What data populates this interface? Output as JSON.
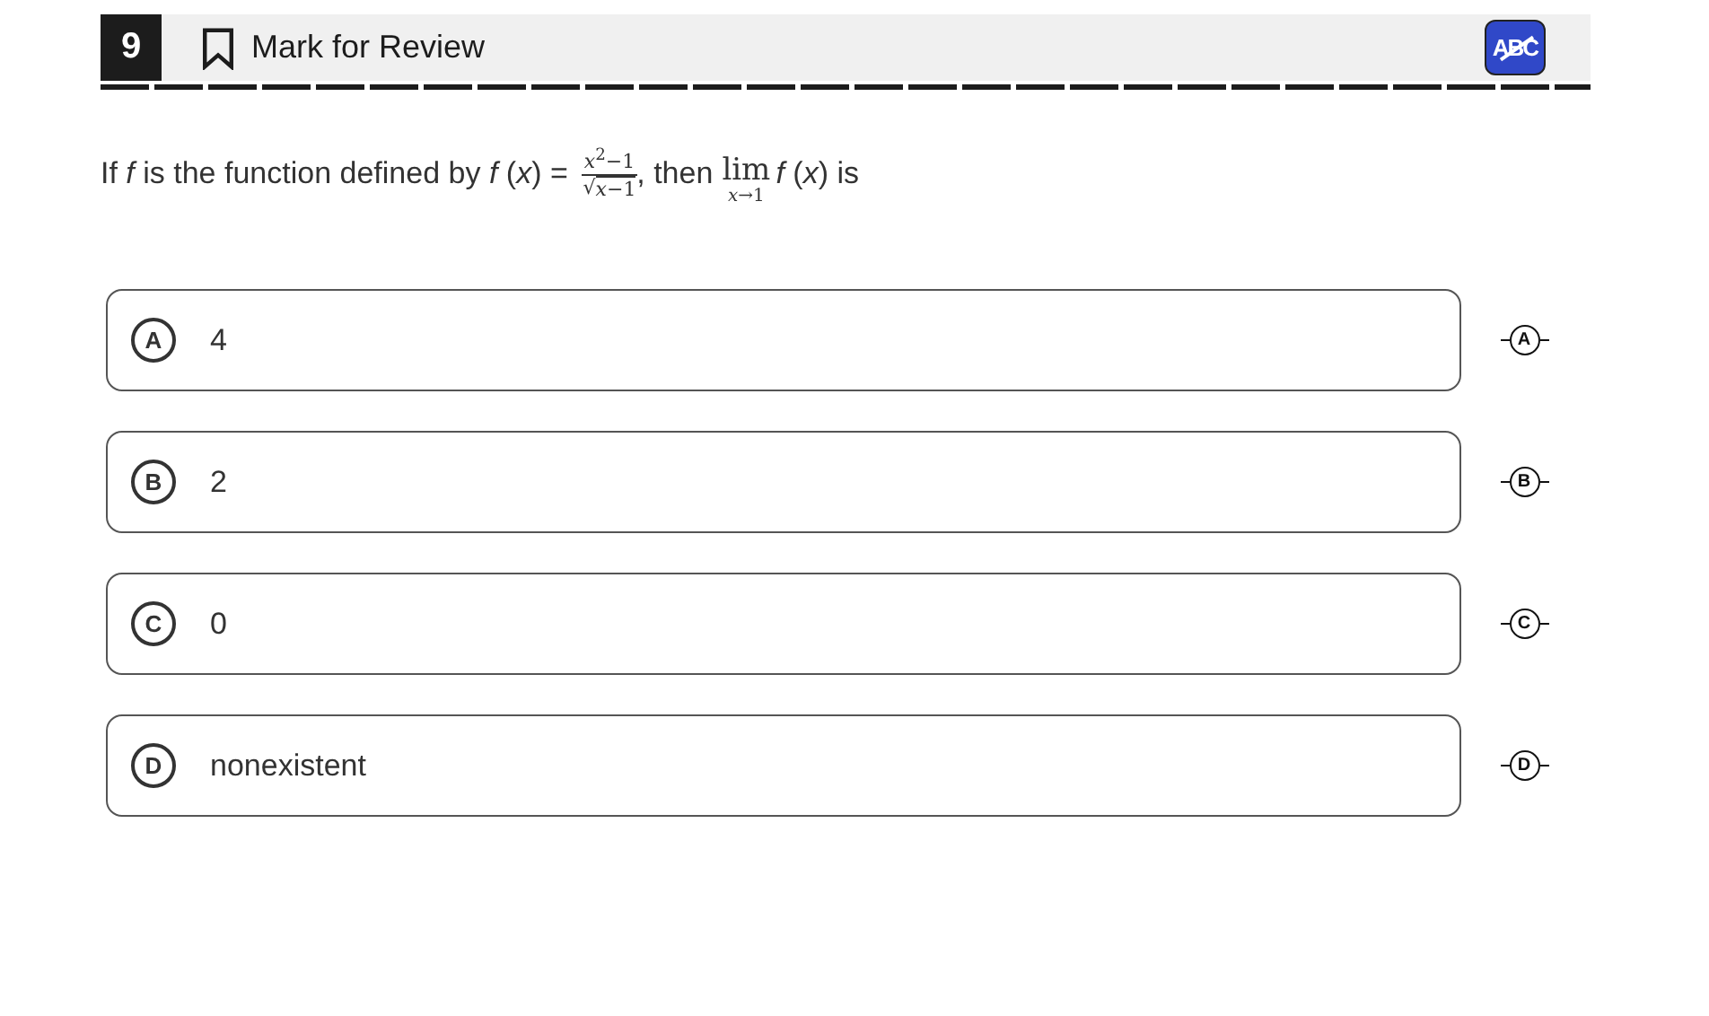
{
  "header": {
    "number": "9",
    "mark_label": "Mark for Review",
    "marked": false,
    "eliminator": {
      "label": "ABC",
      "on": true
    }
  },
  "question": {
    "lead": "If *f* is the function defined by *f* (*x*) =",
    "numerator": "*x*$^{2}$−1",
    "radical": "√",
    "radicand": "*x*−1",
    "middle": ", then",
    "limit": "lim",
    "limit_sub": "*x*→1",
    "tail": "*f* (*x*) is"
  },
  "choices": [
    {
      "letter": "A",
      "text": "4",
      "selected": false,
      "strike_letter": "A"
    },
    {
      "letter": "B",
      "text": "2",
      "selected": false,
      "strike_letter": "B"
    },
    {
      "letter": "C",
      "text": "0",
      "selected": false,
      "strike_letter": "C"
    },
    {
      "letter": "D",
      "text": "nonexistent",
      "selected": false,
      "strike_letter": "D"
    }
  ]
}
